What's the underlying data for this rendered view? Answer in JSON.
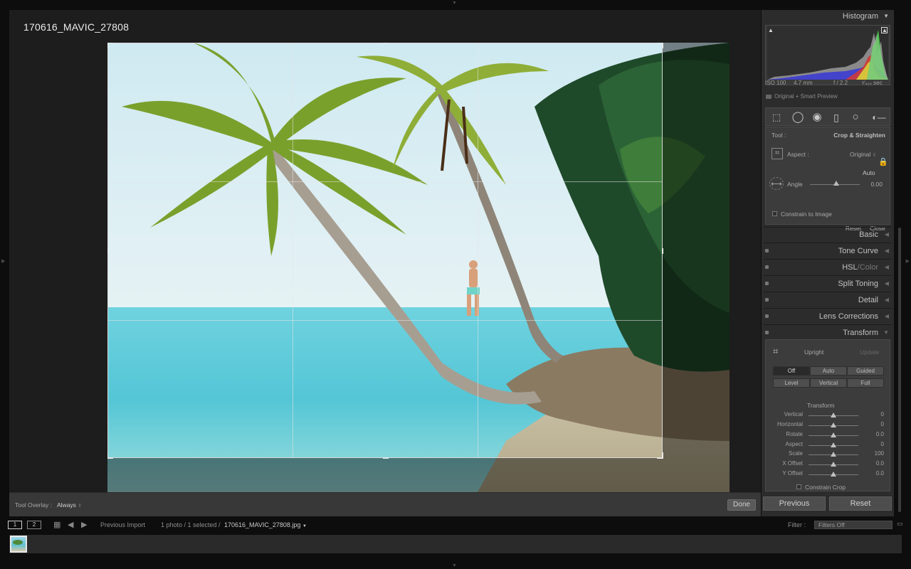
{
  "photo": {
    "title": "170616_MAVIC_27808"
  },
  "toolbar": {
    "overlay_label": "Tool Overlay :",
    "overlay_value": "Always",
    "overlay_arrow": "⇕",
    "done_label": "Done"
  },
  "histogram": {
    "title": "Histogram",
    "iso": "ISO 100",
    "focal": "4.7 mm",
    "aperture": "f / 2.2",
    "shutter": "¹⁄₄₀₀ sec",
    "preview": "Original + Smart Preview"
  },
  "crop": {
    "tool_label": "Tool :",
    "tool_value": "Crop & Straighten",
    "aspect_label": "Aspect :",
    "aspect_value": "Original",
    "auto_label": "Auto",
    "angle_label": "Angle",
    "angle_value": "0.00",
    "constrain_label": "Constrain to Image",
    "reset_label": "Reset",
    "close_label": "Close"
  },
  "panels": {
    "basic": "Basic",
    "tone_curve": "Tone Curve",
    "hsl": "HSL",
    "hsl_sep": "/",
    "color": "Color",
    "split_toning": "Split Toning",
    "detail": "Detail",
    "lens_corrections": "Lens Corrections",
    "transform": "Transform"
  },
  "transform": {
    "upright_label": "Upright",
    "update_label": "Update",
    "buttons_row1": [
      "Off",
      "Auto",
      "Guided"
    ],
    "buttons_row2": [
      "Level",
      "Vertical",
      "Full"
    ],
    "section_label": "Transform",
    "sliders": [
      {
        "label": "Vertical",
        "value": "0"
      },
      {
        "label": "Horizontal",
        "value": "0"
      },
      {
        "label": "Rotate",
        "value": "0.0"
      },
      {
        "label": "Aspect",
        "value": "0"
      },
      {
        "label": "Scale",
        "value": "100"
      },
      {
        "label": "X Offset",
        "value": "0.0"
      },
      {
        "label": "Y Offset",
        "value": "0.0"
      }
    ],
    "constrain_crop": "Constrain Crop"
  },
  "buttons": {
    "previous": "Previous",
    "reset": "Reset"
  },
  "filmbar": {
    "screen1": "1",
    "screen2": "2",
    "source": "Previous Import",
    "count": "1 photo / 1 selected /",
    "filename": "170616_MAVIC_27808.jpg",
    "filter_label": "Filter :",
    "filter_value": "Filters Off"
  },
  "colors": {
    "accent_lock": "#c9a43e",
    "panel_bg": "#2c2c2c",
    "work_bg": "#1d1d1d"
  }
}
